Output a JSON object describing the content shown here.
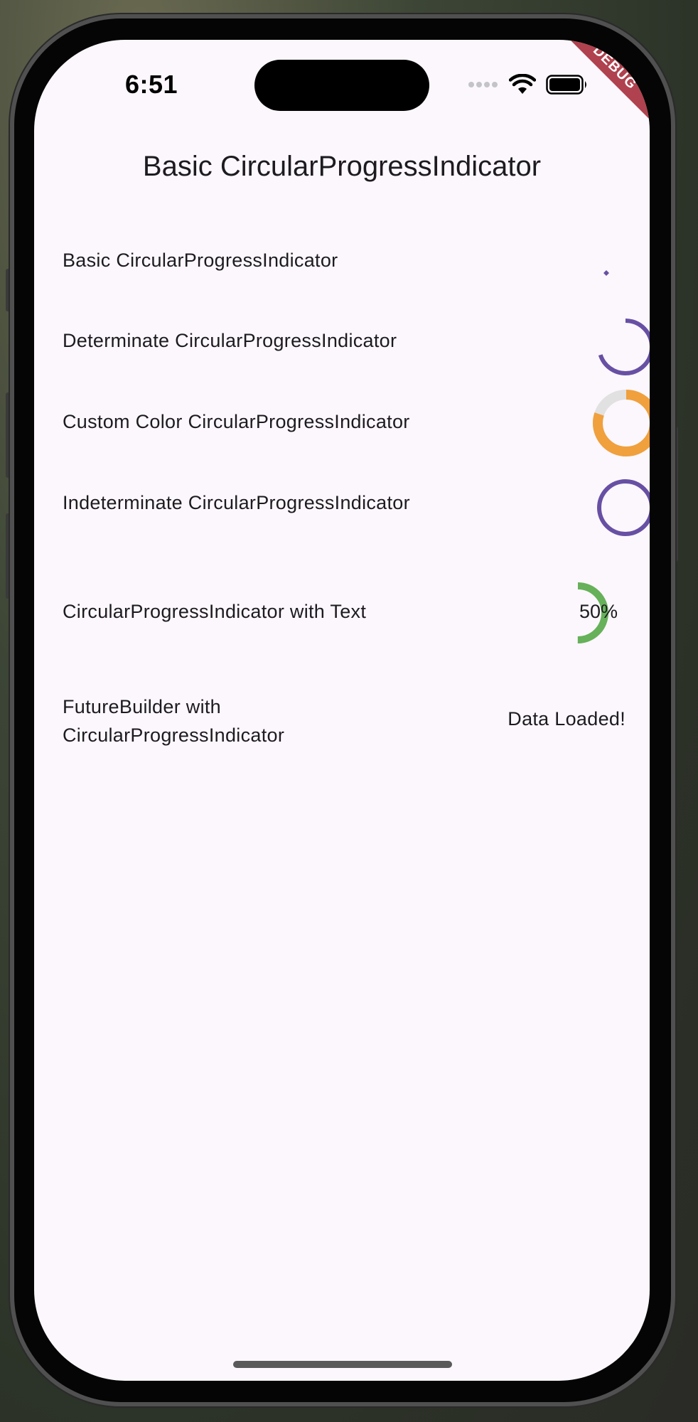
{
  "status_bar": {
    "time": "6:51",
    "icons": [
      "cellular-dots-icon",
      "wifi-icon",
      "battery-icon"
    ]
  },
  "debug_banner": "DEBUG",
  "app_bar": {
    "title": "Basic CircularProgressIndicator"
  },
  "rows": [
    {
      "label": "Basic CircularProgressIndicator",
      "indicator": "indeterminate-spinner",
      "color": "#6750a4"
    },
    {
      "label": "Determinate CircularProgressIndicator",
      "indicator": "determinate",
      "value": 0.7,
      "color": "#6750a4"
    },
    {
      "label": "Custom Color CircularProgressIndicator",
      "indicator": "determinate",
      "value": 0.8,
      "color": "#f0a03c",
      "track_color": "#e1e1e1"
    },
    {
      "label": "Indeterminate CircularProgressIndicator",
      "indicator": "indeterminate",
      "color": "#6750a4"
    },
    {
      "label": "CircularProgressIndicator with Text",
      "indicator": "determinate",
      "value": 0.5,
      "color": "#66b15a",
      "text": "50%"
    },
    {
      "label": "FutureBuilder with CircularProgressIndicator",
      "label_lines": [
        "FutureBuilder with",
        "CircularProgressIndicator"
      ],
      "result": "Data Loaded!"
    }
  ]
}
